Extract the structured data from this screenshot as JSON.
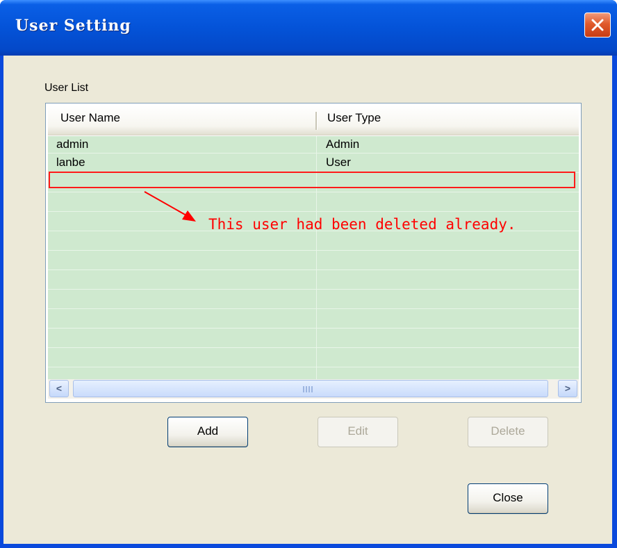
{
  "window": {
    "title": "User Setting",
    "close_label": "×"
  },
  "user_list": {
    "group_label": "User List",
    "columns": [
      "User Name",
      "User Type"
    ],
    "rows": [
      {
        "name": "admin",
        "type": "Admin"
      },
      {
        "name": "lanbe",
        "type": "User"
      }
    ],
    "empty_row_highlighted": true,
    "scroll_left": "<",
    "scroll_right": ">"
  },
  "annotation": {
    "text": "This user had been deleted already.",
    "color": "#ff0000"
  },
  "buttons": {
    "add": "Add",
    "edit": "Edit",
    "delete": "Delete",
    "close": "Close"
  },
  "colors": {
    "titlebar": "#0453d8",
    "dialog_background": "#ece9d8",
    "list_background": "#cfe9cf",
    "close_button": "#e05a2c"
  }
}
